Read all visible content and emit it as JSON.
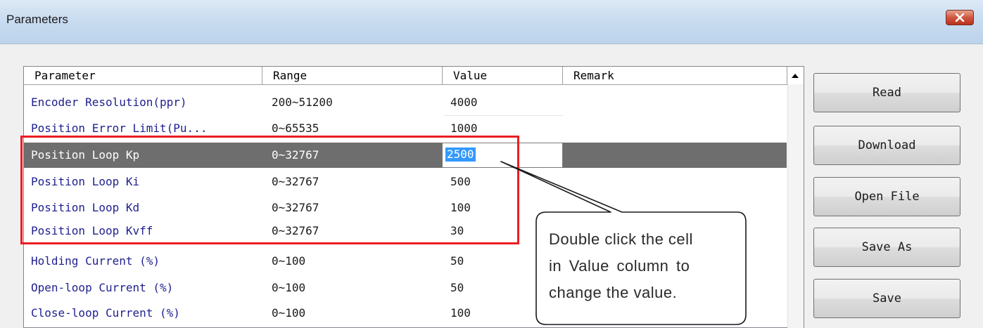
{
  "window": {
    "title": "Parameters",
    "close_icon": "close-icon"
  },
  "table": {
    "columns": [
      "Parameter",
      "Range",
      "Value",
      "Remark"
    ],
    "rows": [
      {
        "name": "Encoder Resolution(ppr)",
        "range": "200~51200",
        "value": "4000",
        "remark": ""
      },
      {
        "name": "Position Error Limit(Pu...",
        "range": "0~65535",
        "value": "1000",
        "remark": ""
      },
      {
        "name": "Position Loop Kp",
        "range": "0~32767",
        "value": "2500",
        "remark": ""
      },
      {
        "name": "Position Loop Ki",
        "range": "0~32767",
        "value": "500",
        "remark": ""
      },
      {
        "name": "Position Loop Kd",
        "range": "0~32767",
        "value": "100",
        "remark": ""
      },
      {
        "name": "Position Loop Kvff",
        "range": "0~32767",
        "value": "30",
        "remark": ""
      },
      {
        "name": "Holding Current (%)",
        "range": "0~100",
        "value": "50",
        "remark": ""
      },
      {
        "name": "Open-loop Current (%)",
        "range": "0~100",
        "value": "50",
        "remark": ""
      },
      {
        "name": "Close-loop Current (%)",
        "range": "0~100",
        "value": "100",
        "remark": ""
      }
    ],
    "selected_row_index": 2,
    "editing_value": "2500"
  },
  "buttons": {
    "read": "Read",
    "download": "Download",
    "open_file": "Open File",
    "save_as": "Save As",
    "save": "Save"
  },
  "callout": {
    "line1": "Double click the cell",
    "line2": "in Value column to",
    "line3": "change the value."
  },
  "colors": {
    "highlight": "#ec1c24",
    "selected_row": "#6e6e6e",
    "selection": "#3399ff",
    "parameter_text": "#1f1f8f"
  }
}
